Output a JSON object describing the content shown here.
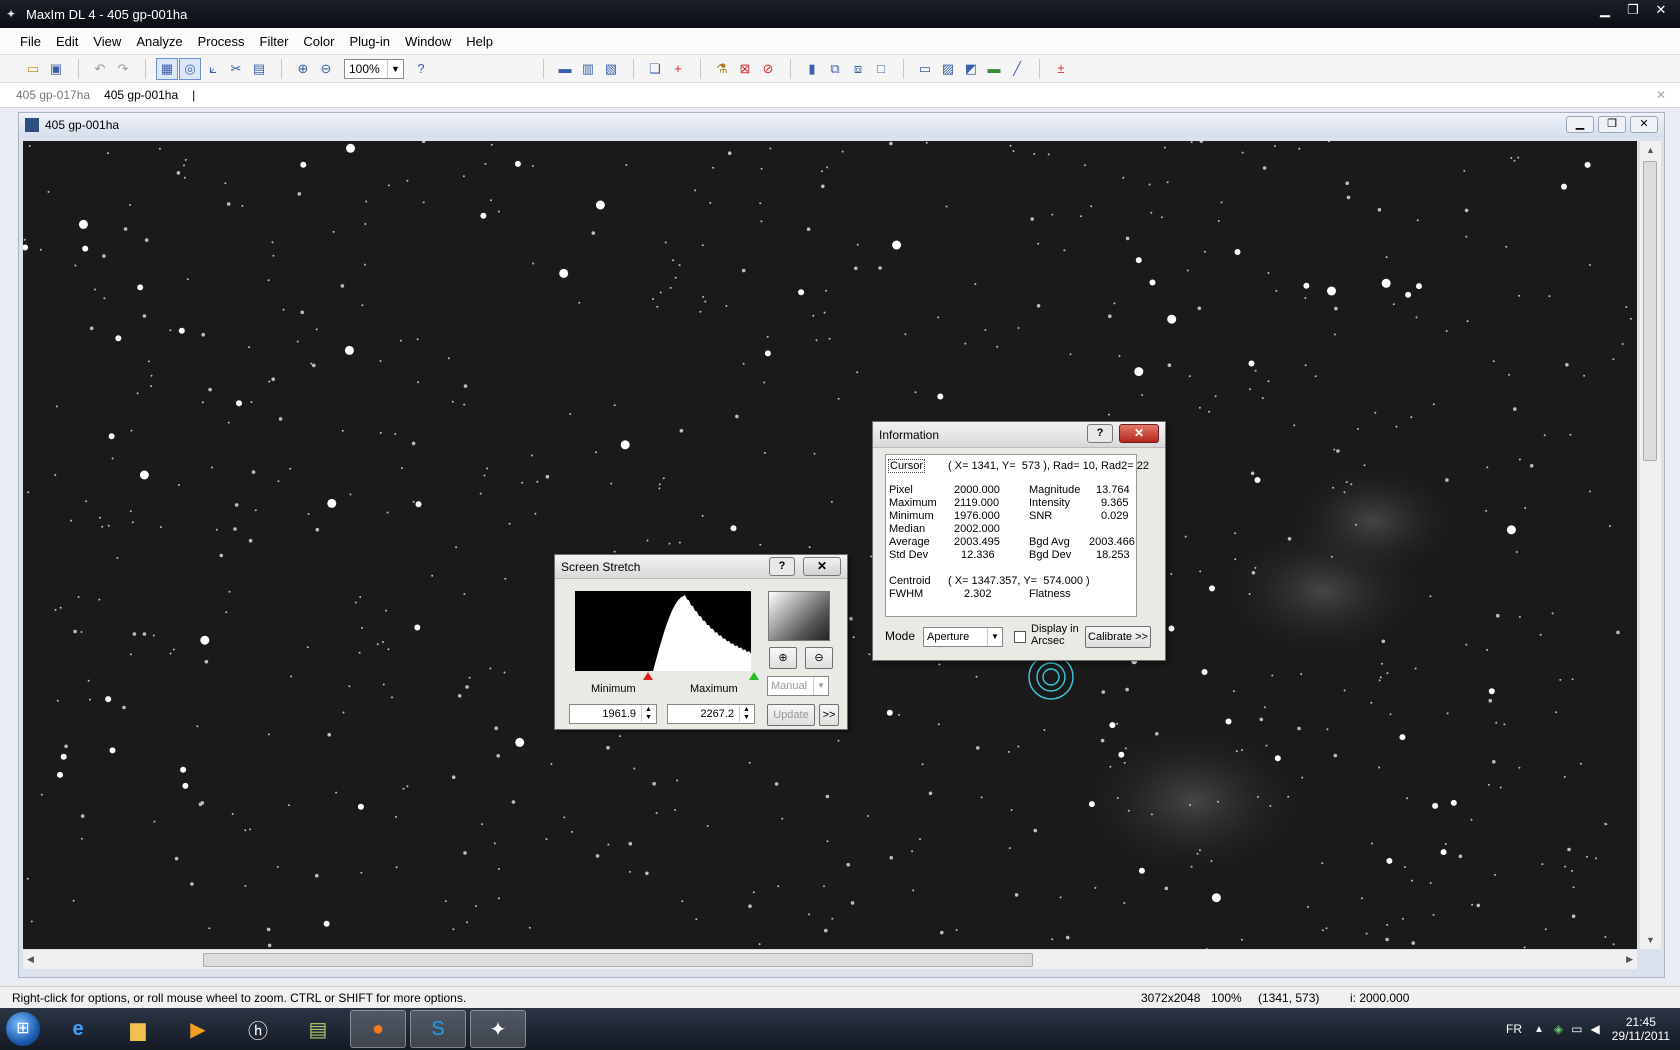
{
  "window": {
    "title": "MaxIm DL 4 - 405 gp-001ha"
  },
  "menu": [
    "File",
    "Edit",
    "View",
    "Analyze",
    "Process",
    "Filter",
    "Color",
    "Plug-in",
    "Window",
    "Help"
  ],
  "toolbar": {
    "zoom_value": "100%"
  },
  "doc_tabs": [
    "405 gp-017ha",
    "405 gp-001ha"
  ],
  "image_window": {
    "title": "405 gp-001ha"
  },
  "information": {
    "title": "Information",
    "help": "?",
    "close": "✕",
    "cursor_label": "Cursor",
    "cursor_value": "( X= 1341, Y=  573 ), Rad= 10, Rad2= 22",
    "rows": [
      {
        "l1": "Pixel",
        "v1": "2000.000",
        "l2": "Magnitude",
        "v2": "13.764"
      },
      {
        "l1": "Maximum",
        "v1": "2119.000",
        "l2": "Intensity",
        "v2": "9.365"
      },
      {
        "l1": "Minimum",
        "v1": "1976.000",
        "l2": "SNR",
        "v2": "0.029"
      },
      {
        "l1": "Median",
        "v1": "2002.000",
        "l2": "",
        "v2": ""
      },
      {
        "l1": "Average",
        "v1": "2003.495",
        "l2": "Bgd Avg",
        "v2": "2003.466"
      },
      {
        "l1": "Std Dev",
        "v1": "12.336",
        "l2": "Bgd Dev",
        "v2": "18.253"
      }
    ],
    "centroid_label": "Centroid",
    "centroid_value": "( X= 1347.357, Y=  574.000 )",
    "fwhm_label": "FWHM",
    "fwhm_value": "2.302",
    "flatness_label": "Flatness",
    "mode_label": "Mode",
    "mode_value": "Aperture",
    "display_arcsec_label_1": "Display in",
    "display_arcsec_label_2": "Arcsec",
    "calibrate_label": "Calibrate >>"
  },
  "screen_stretch": {
    "title": "Screen Stretch",
    "help": "?",
    "close": "✕",
    "minimum_label": "Minimum",
    "maximum_label": "Maximum",
    "minimum_value": "1961.9",
    "maximum_value": "2267.2",
    "mode_value": "Manual",
    "update_label": "Update",
    "more_label": ">>"
  },
  "status": {
    "message": "Right-click for options, or roll mouse wheel to zoom. CTRL or SHIFT for more options.",
    "dims": "3072x2048",
    "zoom": "100%",
    "coords": "(1341, 573)",
    "intensity": "i:  2000.000"
  },
  "taskbar": {
    "lang": "FR",
    "time": "21:45",
    "date": "29/11/2011"
  },
  "colors": {
    "sky": "#1a1a1a",
    "aperture": "#3ec9d8"
  }
}
